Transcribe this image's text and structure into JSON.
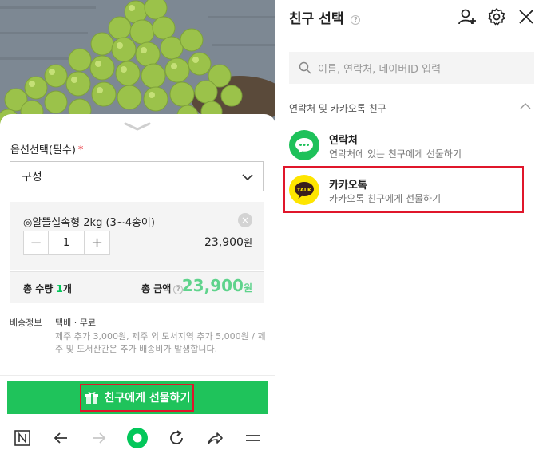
{
  "left": {
    "option_label": "옵션선택(필수)",
    "required_mark": "*",
    "select_value": "구성",
    "item": {
      "name": "◎알뜰실속형 2kg (3~4송이)",
      "remove_icon": "×",
      "qty_minus": "−",
      "quantity": "1",
      "qty_plus": "+",
      "price": "23,900",
      "price_unit": "원"
    },
    "total": {
      "qty_label": "총 수량",
      "qty_value": "1",
      "qty_unit": "개",
      "amount_label": "총 금액",
      "amount_help": "?",
      "amount": "23,900",
      "amount_unit": "원"
    },
    "shipping": {
      "label": "배송정보",
      "method": "택배 · 무료",
      "note": "제주 추가 3,000원, 제주 외 도서지역 추가 5,000원 / 제주 및 도서산간은 추가 배송비가 발생합니다."
    },
    "gift_button": "친구에게 선물하기",
    "browser_bar": [
      "naver-n-icon",
      "back-arrow-icon",
      "forward-arrow-icon",
      "home-dot-icon",
      "refresh-icon",
      "share-icon",
      "menu-icon"
    ]
  },
  "right": {
    "title": "친구 선택",
    "title_help": "?",
    "search_placeholder": "이름, 연락처, 네이버ID 입력",
    "section_label": "연락처 및 카카오톡 친구",
    "rows": [
      {
        "title": "연락처",
        "subtitle": "연락처에 있는 친구에게 선물하기",
        "icon": "message-bubble-icon",
        "color": "#1ec15a"
      },
      {
        "title": "카카오톡",
        "subtitle": "카카오톡 친구에게 선물하기",
        "icon": "kakaotalk-icon",
        "color": "#fee500"
      }
    ]
  },
  "colors": {
    "brand_green": "#1fc35b",
    "highlight_red": "#e0162b",
    "amount_green": "#5fd38c"
  }
}
